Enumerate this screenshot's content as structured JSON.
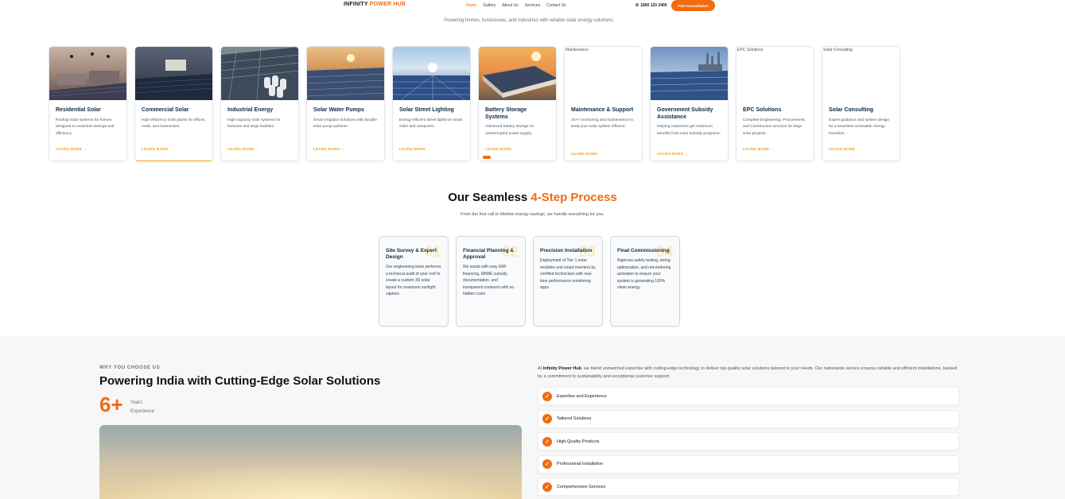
{
  "nav": {
    "logo_part1": "INFINITY",
    "logo_part2": "POWER HUB",
    "links": [
      "Home",
      "Gallery",
      "About Us",
      "Services",
      "Contact Us"
    ],
    "phone": "1800 120 2400",
    "cta": "Free Consultation"
  },
  "tagline": "Powering homes, businesses, and industries with reliable solar energy solutions.",
  "services": [
    {
      "title": "Residential Solar",
      "desc": "Rooftop solar systems for homes designed to maximize savings and efficiency.",
      "link": "LEARN MORE →",
      "alt": ""
    },
    {
      "title": "Commercial Solar",
      "desc": "High-efficiency solar plants for offices, malls, and businesses.",
      "link": "LEARN MORE →",
      "alt": ""
    },
    {
      "title": "Industrial Energy",
      "desc": "High-capacity solar systems for factories and large facilities.",
      "link": "LEARN MORE →",
      "alt": ""
    },
    {
      "title": "Solar Water Pumps",
      "desc": "Smart irrigation solutions with durable solar pump systems.",
      "link": "LEARN MORE →",
      "alt": ""
    },
    {
      "title": "Solar Street Lighting",
      "desc": "Energy-efficient street lights for smart cities and campuses.",
      "link": "LEARN MORE →",
      "alt": ""
    },
    {
      "title": "Battery Storage Systems",
      "desc": "Advanced battery storage for uninterrupted power supply.",
      "link": "LEARN MORE →",
      "alt": ""
    },
    {
      "title": "Maintenance & Support",
      "desc": "24×7 monitoring and maintenance to keep your solar system efficient.",
      "link": "LEARN MORE →",
      "alt": "Maintenance"
    },
    {
      "title": "Government Subsidy Assistance",
      "desc": "Helping customers get maximum benefits from solar subsidy programs.",
      "link": "LEARN MORE →",
      "alt": ""
    },
    {
      "title": "EPC Solutions",
      "desc": "Complete Engineering, Procurement, and Construction services for large solar projects.",
      "link": "LEARN MORE →",
      "alt": "EPC Solutions"
    },
    {
      "title": "Solar Consulting",
      "desc": "Expert guidance and system design for a seamless renewable energy transition.",
      "link": "LEARN MORE →",
      "alt": "Solar Consulting"
    }
  ],
  "process": {
    "title_main": "Our Seamless ",
    "title_accent": "4-Step Process",
    "subtitle": "From the first call to lifetime energy savings, we handle everything for you.",
    "steps": [
      {
        "num": "01",
        "title": "Site Survey & Expert Design",
        "desc": "Our engineering team performs a technical audit of your roof to create a custom 3D solar layout for maximum sunlight capture."
      },
      {
        "num": "02",
        "title": "Financial Planning & Approval",
        "desc": "We assist with easy EMI financing, MNRE subsidy documentation, and transparent contracts with no hidden costs."
      },
      {
        "num": "03",
        "title": "Precision Installation",
        "desc": "Deployment of Tier-1 solar modules and smart inverters by certified technicians with real-time performance monitoring apps."
      },
      {
        "num": "04",
        "title": "Final Commissioning",
        "desc": "Rigorous safety testing, wiring optimization, and net-metering activation to ensure your system is generating 100% clean energy."
      }
    ]
  },
  "why": {
    "eyebrow": "WHY YOU CHOOSE US",
    "title": "Powering India with Cutting-Edge Solar Solutions",
    "exp_num": "6+",
    "exp_label": "Years Experience",
    "para_prefix": "At ",
    "para_brand": "Infinity Power Hub",
    "para_rest": ", we blend unmatched expertise with cutting-edge technology to deliver top-quality solar solutions tailored to your needs. Our nationwide service ensures reliable and efficient installations, backed by a commitment to sustainability and exceptional customer support.",
    "features": [
      "Expertise and Experience",
      "Tailored Solutions",
      "High-Quality Products",
      "Professional Installation",
      "Comprehensive Services"
    ]
  },
  "colors": {
    "accent": "#f26b10",
    "navy": "#0f2a44",
    "gold": "#f59e0b"
  }
}
